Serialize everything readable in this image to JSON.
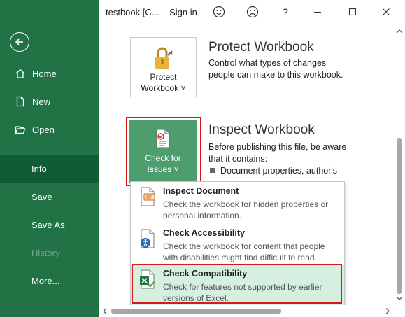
{
  "window": {
    "title": "testbook  [C...",
    "sign_in": "Sign in",
    "help": "?"
  },
  "sidebar": {
    "items": [
      {
        "label": "Home"
      },
      {
        "label": "New"
      },
      {
        "label": "Open"
      },
      {
        "label": "Info"
      },
      {
        "label": "Save"
      },
      {
        "label": "Save As"
      },
      {
        "label": "History"
      },
      {
        "label": "More..."
      }
    ]
  },
  "protect": {
    "button_line1": "Protect",
    "button_line2": "Workbook ˅",
    "title": "Protect Workbook",
    "description": "Control what types of changes people can make to this workbook."
  },
  "inspect": {
    "button_line1": "Check for",
    "button_line2": "Issues ˅",
    "title": "Inspect Workbook",
    "description": "Before publishing this file, be aware that it contains:",
    "bullet": "Document properties, author's"
  },
  "menu": {
    "items": [
      {
        "title": "Inspect Document",
        "description": "Check the workbook for hidden properties or personal information."
      },
      {
        "title": "Check Accessibility",
        "description": "Check the workbook for content that people with disabilities might find difficult to read."
      },
      {
        "title": "Check Compatibility",
        "description": "Check for features not supported by earlier versions of Excel."
      }
    ]
  },
  "colors": {
    "sidebar_bg": "#217346",
    "active_item_bg": "#0f5c35",
    "highlight_border": "#d7191c",
    "hover_item_bg": "#d5efe0"
  }
}
